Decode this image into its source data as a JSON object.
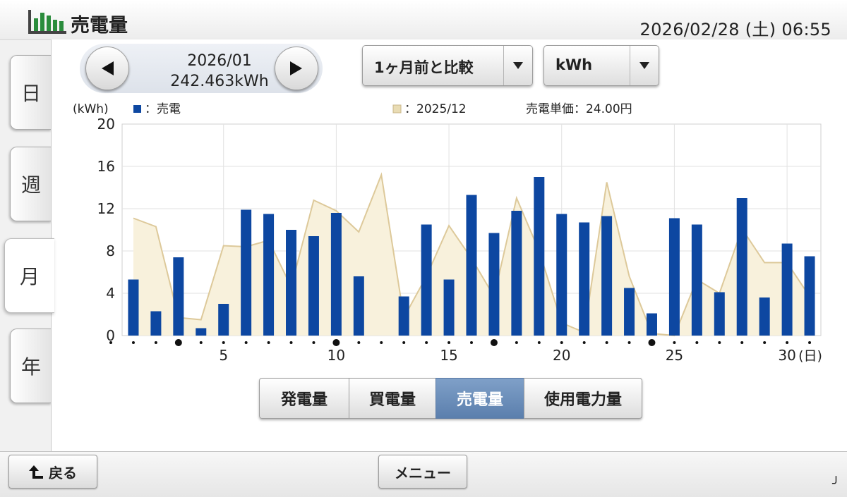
{
  "header": {
    "title": "売電量",
    "datetime": "2026/02/28 (土) 06:55"
  },
  "tabs": [
    {
      "label": "日",
      "active": false
    },
    {
      "label": "週",
      "active": false
    },
    {
      "label": "月",
      "active": true
    },
    {
      "label": "年",
      "active": false
    }
  ],
  "period": {
    "month": "2026/01",
    "total": "242.463kWh"
  },
  "compare_dropdown": {
    "label": "1ヶ月前と比較"
  },
  "unit_dropdown": {
    "label": "kWh"
  },
  "legend": {
    "unit": "(kWh)",
    "current": "：売電",
    "compare": "：2025/12",
    "price": "売電単価：24.00円"
  },
  "colors": {
    "bar": "#0d47a1",
    "area_fill": "#f8f1dc",
    "area_line": "#ddc99a",
    "active_segment": "#5b7fad"
  },
  "chart_data": {
    "type": "bar",
    "x": [
      1,
      2,
      3,
      4,
      5,
      6,
      7,
      8,
      9,
      10,
      11,
      12,
      13,
      14,
      15,
      16,
      17,
      18,
      19,
      20,
      21,
      22,
      23,
      24,
      25,
      26,
      27,
      28,
      29,
      30,
      31
    ],
    "series": [
      {
        "name": "売電",
        "type": "bar",
        "values": [
          5.3,
          2.3,
          7.4,
          0.7,
          3.0,
          11.9,
          11.5,
          10.0,
          9.4,
          11.6,
          5.6,
          0,
          3.7,
          10.5,
          5.3,
          13.3,
          9.7,
          11.8,
          15.0,
          11.5,
          10.7,
          11.3,
          4.5,
          2.1,
          11.1,
          10.5,
          4.1,
          13.0,
          3.6,
          8.7,
          7.5
        ]
      },
      {
        "name": "2025/12",
        "type": "area",
        "values": [
          11.1,
          10.3,
          1.7,
          1.5,
          8.5,
          8.4,
          9.0,
          4.6,
          12.8,
          11.8,
          9.8,
          15.2,
          1.7,
          5.6,
          10.4,
          7.3,
          3.7,
          13.0,
          8.0,
          1.2,
          0.3,
          14.5,
          5.6,
          0.2,
          0.0,
          5.3,
          4.0,
          10.1,
          6.9,
          6.9,
          3.7
        ]
      }
    ],
    "ylim": [
      0,
      20
    ],
    "yticks": [
      "20",
      "16",
      "12",
      "8",
      "4",
      "0"
    ],
    "xtick_labels": [
      "5",
      "10",
      "15",
      "20",
      "25",
      "30"
    ],
    "x_suffix": "(日)",
    "ylabel": "(kWh)",
    "grid": true
  },
  "segments": [
    {
      "label": "発電量",
      "active": false
    },
    {
      "label": "買電量",
      "active": false
    },
    {
      "label": "売電量",
      "active": true
    },
    {
      "label": "使用電力量",
      "active": false
    }
  ],
  "footer": {
    "back_label": "戻る",
    "menu_label": "メニュー",
    "corner_glyph": "╯"
  }
}
